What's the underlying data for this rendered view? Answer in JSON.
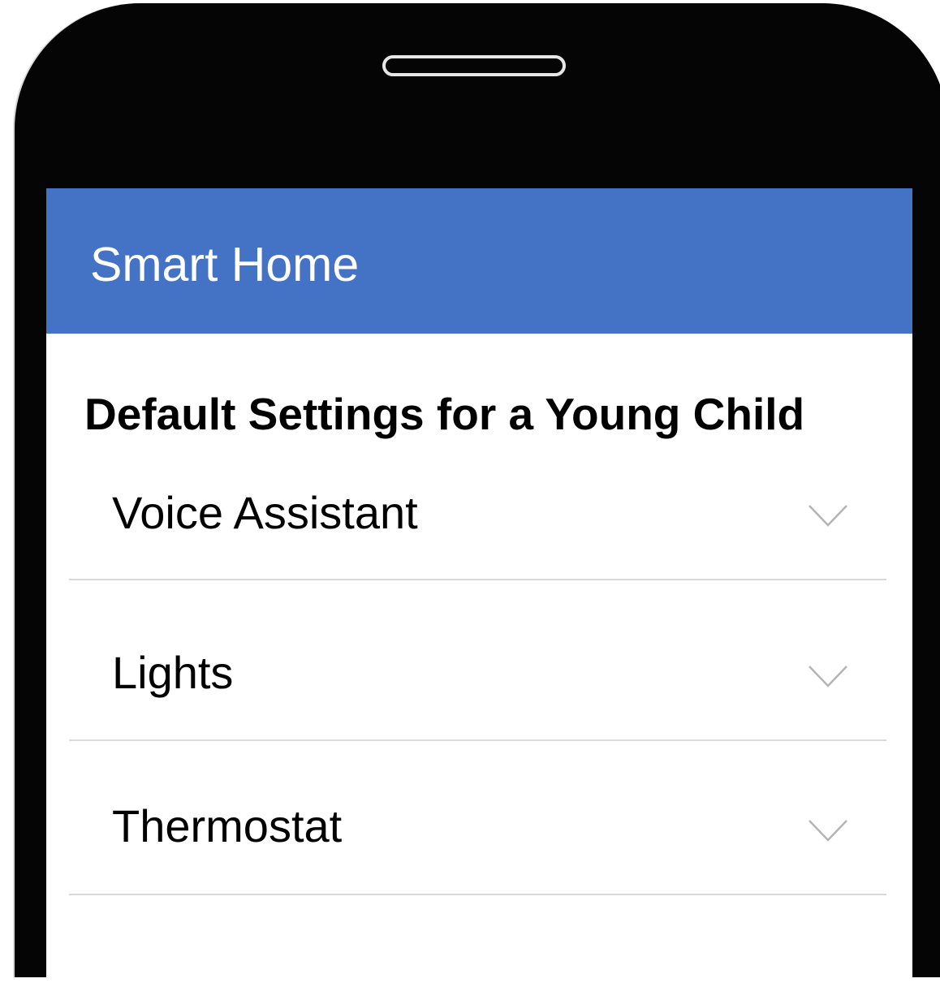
{
  "device": {
    "type": "smartphone"
  },
  "app": {
    "title": "Smart Home",
    "accent_color": "#4472c4"
  },
  "section": {
    "title": "Default Settings for a Young Child"
  },
  "settings": [
    {
      "label": "Voice Assistant",
      "icon": "chevron-down-icon",
      "expanded": false
    },
    {
      "label": "Lights",
      "icon": "chevron-down-icon",
      "expanded": false
    },
    {
      "label": "Thermostat",
      "icon": "chevron-down-icon",
      "expanded": false
    }
  ]
}
